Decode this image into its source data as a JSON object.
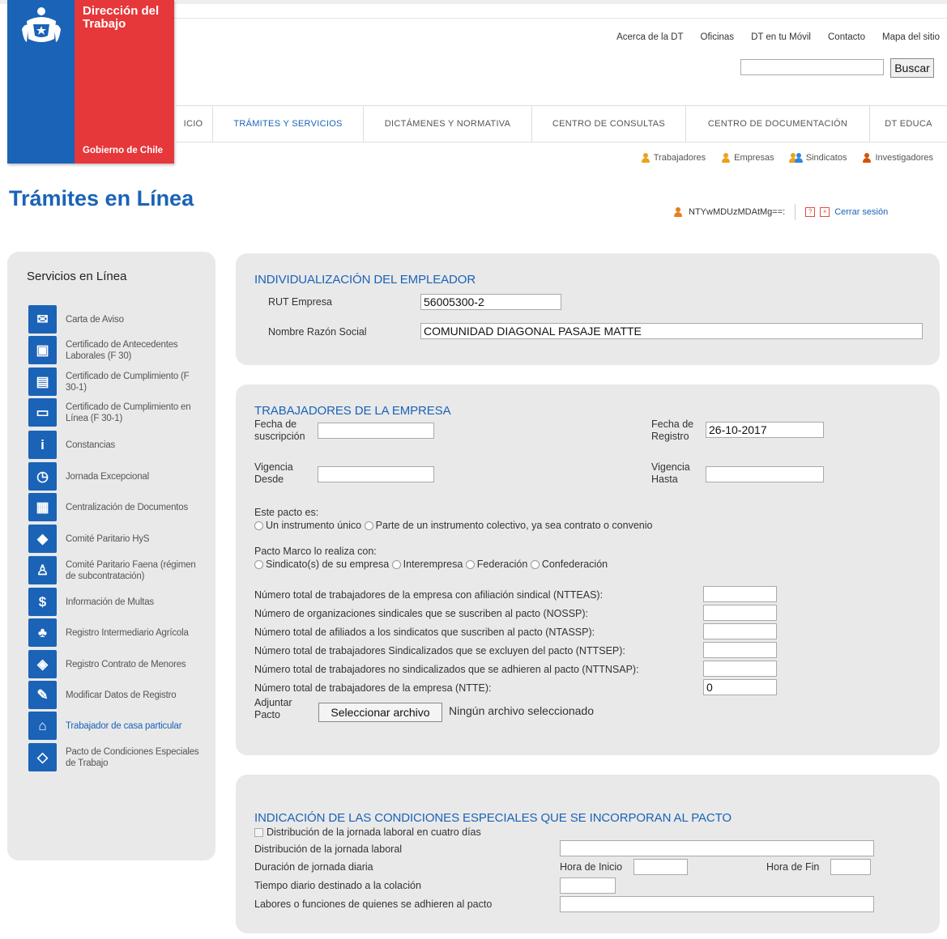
{
  "brand": {
    "line1": "Dirección del",
    "line2": "Trabajo",
    "gov": "Gobierno de Chile"
  },
  "top_links": [
    "Acerca de la DT",
    "Oficinas",
    "DT en tu Móvil",
    "Contacto",
    "Mapa del sitio"
  ],
  "search": {
    "value": "",
    "button": "Buscar"
  },
  "nav": [
    "ICIO",
    "TRÁMITES Y SERVICIOS",
    "DICTÁMENES Y NORMATIVA",
    "CENTRO DE CONSULTAS",
    "CENTRO DE DOCUMENTACIÓN",
    "DT EDUCA"
  ],
  "nav_active": "TRÁMITES Y SERVICIOS",
  "audience": [
    {
      "label": "Trabajadores",
      "color": "#e8a31d"
    },
    {
      "label": "Empresas",
      "color": "#e8a31d"
    },
    {
      "label": "Sindicatos",
      "color": "#e8a31d"
    },
    {
      "label": "Investigadores",
      "color": "#d35400"
    }
  ],
  "page_title": "Trámites en Línea",
  "user": {
    "id": "NTYwMDUzMDAtMg==:",
    "logout": "Cerrar sesión"
  },
  "sidebar": {
    "title": "Servicios en Línea",
    "items": [
      {
        "label": "Carta de Aviso",
        "icon": "letter-icon"
      },
      {
        "label": "Certificado de Antecedentes Laborales (F 30)",
        "icon": "certificate-icon"
      },
      {
        "label": "Certificado de Cumplimiento (F 30-1)",
        "icon": "document-icon"
      },
      {
        "label": "Certificado de Cumplimiento en Línea (F 30-1)",
        "icon": "computer-icon"
      },
      {
        "label": "Constancias",
        "icon": "info-icon"
      },
      {
        "label": "Jornada Excepcional",
        "icon": "clock-icon"
      },
      {
        "label": "Centralización de Documentos",
        "icon": "folders-icon"
      },
      {
        "label": "Comité Paritario HyS",
        "icon": "committee-icon"
      },
      {
        "label": "Comité Paritario Faena (régimen de subcontratación)",
        "icon": "worker-icon"
      },
      {
        "label": "Información de Multas",
        "icon": "dollar-icon"
      },
      {
        "label": "Registro Intermediario Agrícola",
        "icon": "agriculture-icon"
      },
      {
        "label": "Registro Contrato de Menores",
        "icon": "minors-icon"
      },
      {
        "label": "Modificar Datos de Registro",
        "icon": "edit-icon"
      },
      {
        "label": "Trabajador de casa particular",
        "icon": "home-icon"
      },
      {
        "label": "Pacto de Condiciones Especiales de Trabajo",
        "icon": "handshake-icon"
      }
    ]
  },
  "empleador": {
    "title": "INDIVIDUALIZACIÓN DEL EMPLEADOR",
    "rut_label": "RUT Empresa",
    "rut_value": "56005300-2",
    "razon_label": "Nombre Razón Social",
    "razon_value": "COMUNIDAD DIAGONAL PASAJE MATTE"
  },
  "trabajadores": {
    "title": "TRABAJADORES DE LA EMPRESA",
    "fecha_suscripcion_label": "Fecha de suscripción",
    "fecha_suscripcion_value": "",
    "fecha_registro_label": "Fecha de Registro",
    "fecha_registro_value": "26-10-2017",
    "vigencia_desde_label": "Vigencia Desde",
    "vigencia_desde_value": "",
    "vigencia_hasta_label": "Vigencia Hasta",
    "vigencia_hasta_value": "",
    "pacto_es_label": "Este pacto es:",
    "pacto_es_options": [
      "Un instrumento único",
      "Parte de un instrumento colectivo, ya sea contrato o convenio"
    ],
    "pacto_marco_label": "Pacto Marco lo realiza con:",
    "pacto_marco_options": [
      "Sindicato(s) de su empresa",
      "Interempresa",
      "Federación",
      "Confederación"
    ],
    "counts": [
      {
        "label": "Número total de trabajadores de la empresa con afiliación sindical (NTTEAS):",
        "value": ""
      },
      {
        "label": "Número de organizaciones sindicales que se suscriben al pacto (NOSSP):",
        "value": ""
      },
      {
        "label": "Número total de afiliados a los sindicatos que suscriben al pacto (NTASSP):",
        "value": ""
      },
      {
        "label": "Número total de trabajadores Sindicalizados que se excluyen del pacto (NTTSEP):",
        "value": ""
      },
      {
        "label": "Número total de trabajadores no sindicalizados que se adhieren al pacto (NTTNSAP):",
        "value": ""
      },
      {
        "label": "Número total de trabajadores de la empresa (NTTE):",
        "value": "0"
      }
    ],
    "adjuntar_label": "Adjuntar Pacto",
    "file_button": "Seleccionar archivo",
    "file_status": "Ningún archivo seleccionado"
  },
  "condiciones": {
    "title": "INDICACIÓN DE LAS CONDICIONES ESPECIALES QUE SE INCORPORAN AL PACTO",
    "checkbox_label": "Distribución de la jornada laboral en cuatro días",
    "distribucion_label": "Distribución de la jornada laboral",
    "duracion_label": "Duración de jornada diaria",
    "hora_inicio_label": "Hora de Inicio",
    "hora_fin_label": "Hora de Fin",
    "colacion_label": "Tiempo diario destinado a la colación",
    "labores_label": "Labores o funciones de quienes se adhieren al pacto"
  }
}
